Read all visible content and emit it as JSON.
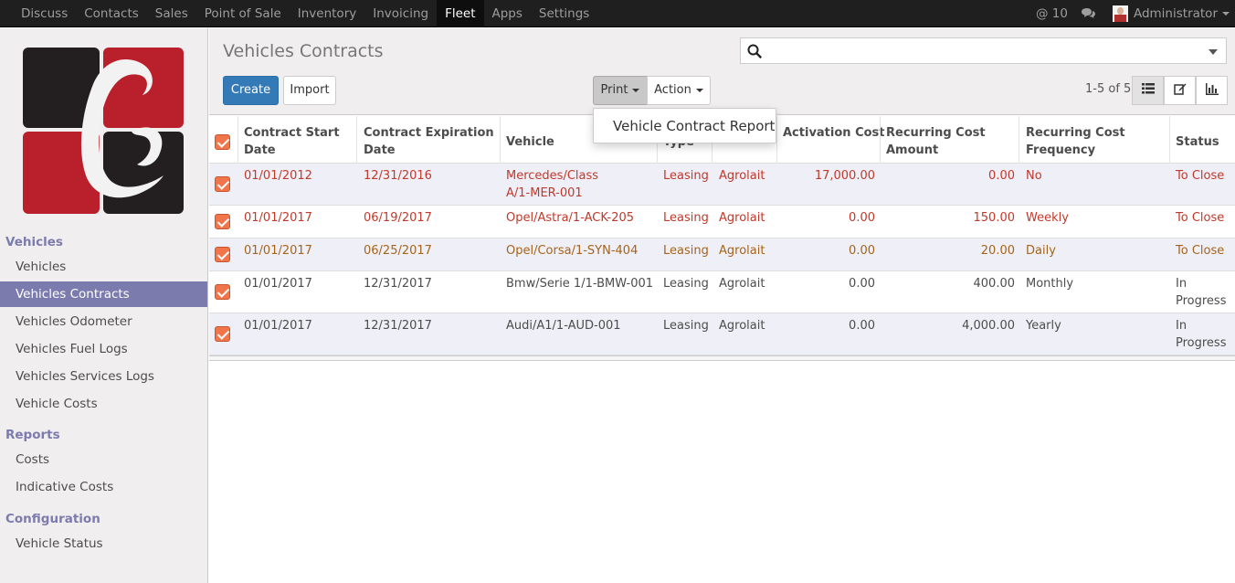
{
  "topbar": {
    "menu": [
      "Discuss",
      "Contacts",
      "Sales",
      "Point of Sale",
      "Inventory",
      "Invoicing",
      "Fleet",
      "Apps",
      "Settings"
    ],
    "active_menu": "Fleet",
    "mentions": "@ 10",
    "user": "Administrator"
  },
  "sidebar": {
    "sections": [
      {
        "title": "Vehicles",
        "items": [
          "Vehicles",
          "Vehicles Contracts",
          "Vehicles Odometer",
          "Vehicles Fuel Logs",
          "Vehicles Services Logs",
          "Vehicle Costs"
        ]
      },
      {
        "title": "Reports",
        "items": [
          "Costs",
          "Indicative Costs"
        ]
      },
      {
        "title": "Configuration",
        "items": [
          "Vehicle Status"
        ]
      }
    ],
    "active_item": "Vehicles Contracts"
  },
  "control_panel": {
    "title": "Vehicles Contracts",
    "search_placeholder": "",
    "create_label": "Create",
    "import_label": "Import",
    "print_label": "Print",
    "action_label": "Action",
    "pager": "1-5 of 5"
  },
  "print_dropdown": {
    "items": [
      "Vehicle Contract Report"
    ]
  },
  "table": {
    "columns": [
      {
        "label_1": "Contract Start",
        "label_2": "Date"
      },
      {
        "label_1": "Contract Expiration",
        "label_2": "Date"
      },
      {
        "label_1": "Vehicle",
        "label_2": ""
      },
      {
        "label_1": "Type",
        "label_2": ""
      },
      {
        "label_1": "",
        "label_2": ""
      },
      {
        "label_1": "Activation Cost",
        "label_2": ""
      },
      {
        "label_1": "Recurring Cost",
        "label_2": "Amount"
      },
      {
        "label_1": "Recurring Cost",
        "label_2": "Frequency"
      },
      {
        "label_1": "Status",
        "label_2": ""
      }
    ],
    "rows": [
      {
        "start": "01/01/2012",
        "expiration": "12/31/2016",
        "vehicle_1": "Mercedes/Class",
        "vehicle_2": "A/1-MER-001",
        "type": "Leasing",
        "supplier": "Agrolait",
        "activation": "17,000.00",
        "amount": "0.00",
        "frequency": "No",
        "status_1": "To Close",
        "status_2": "",
        "tone": "red"
      },
      {
        "start": "01/01/2017",
        "expiration": "06/19/2017",
        "vehicle_1": "Opel/Astra/1-ACK-205",
        "vehicle_2": "",
        "type": "Leasing",
        "supplier": "Agrolait",
        "activation": "0.00",
        "amount": "150.00",
        "frequency": "Weekly",
        "status_1": "To Close",
        "status_2": "",
        "tone": "red"
      },
      {
        "start": "01/01/2017",
        "expiration": "06/25/2017",
        "vehicle_1": "Opel/Corsa/1-SYN-404",
        "vehicle_2": "",
        "type": "Leasing",
        "supplier": "Agrolait",
        "activation": "0.00",
        "amount": "20.00",
        "frequency": "Daily",
        "status_1": "To Close",
        "status_2": "",
        "tone": "brown"
      },
      {
        "start": "01/01/2017",
        "expiration": "12/31/2017",
        "vehicle_1": "Bmw/Serie 1/1-BMW-001",
        "vehicle_2": "",
        "type": "Leasing",
        "supplier": "Agrolait",
        "activation": "0.00",
        "amount": "400.00",
        "frequency": "Monthly",
        "status_1": "In",
        "status_2": "Progress",
        "tone": "dark"
      },
      {
        "start": "01/01/2017",
        "expiration": "12/31/2017",
        "vehicle_1": "Audi/A1/1-AUD-001",
        "vehicle_2": "",
        "type": "Leasing",
        "supplier": "Agrolait",
        "activation": "0.00",
        "amount": "4,000.00",
        "frequency": "Yearly",
        "status_1": "In",
        "status_2": "Progress",
        "tone": "dark"
      }
    ]
  },
  "colors": {
    "brand": "#7c7bad",
    "topbar": "#1f1f1f",
    "primary_button": "#337ab7",
    "checkbox": "#f0754a",
    "to_close": "#c0392b",
    "warning": "#a5641a"
  },
  "icons": {
    "search": "search-icon",
    "chat": "chat-icon",
    "list_view": "list-view-icon",
    "edit_view": "edit-view-icon",
    "graph_view": "graph-view-icon"
  }
}
